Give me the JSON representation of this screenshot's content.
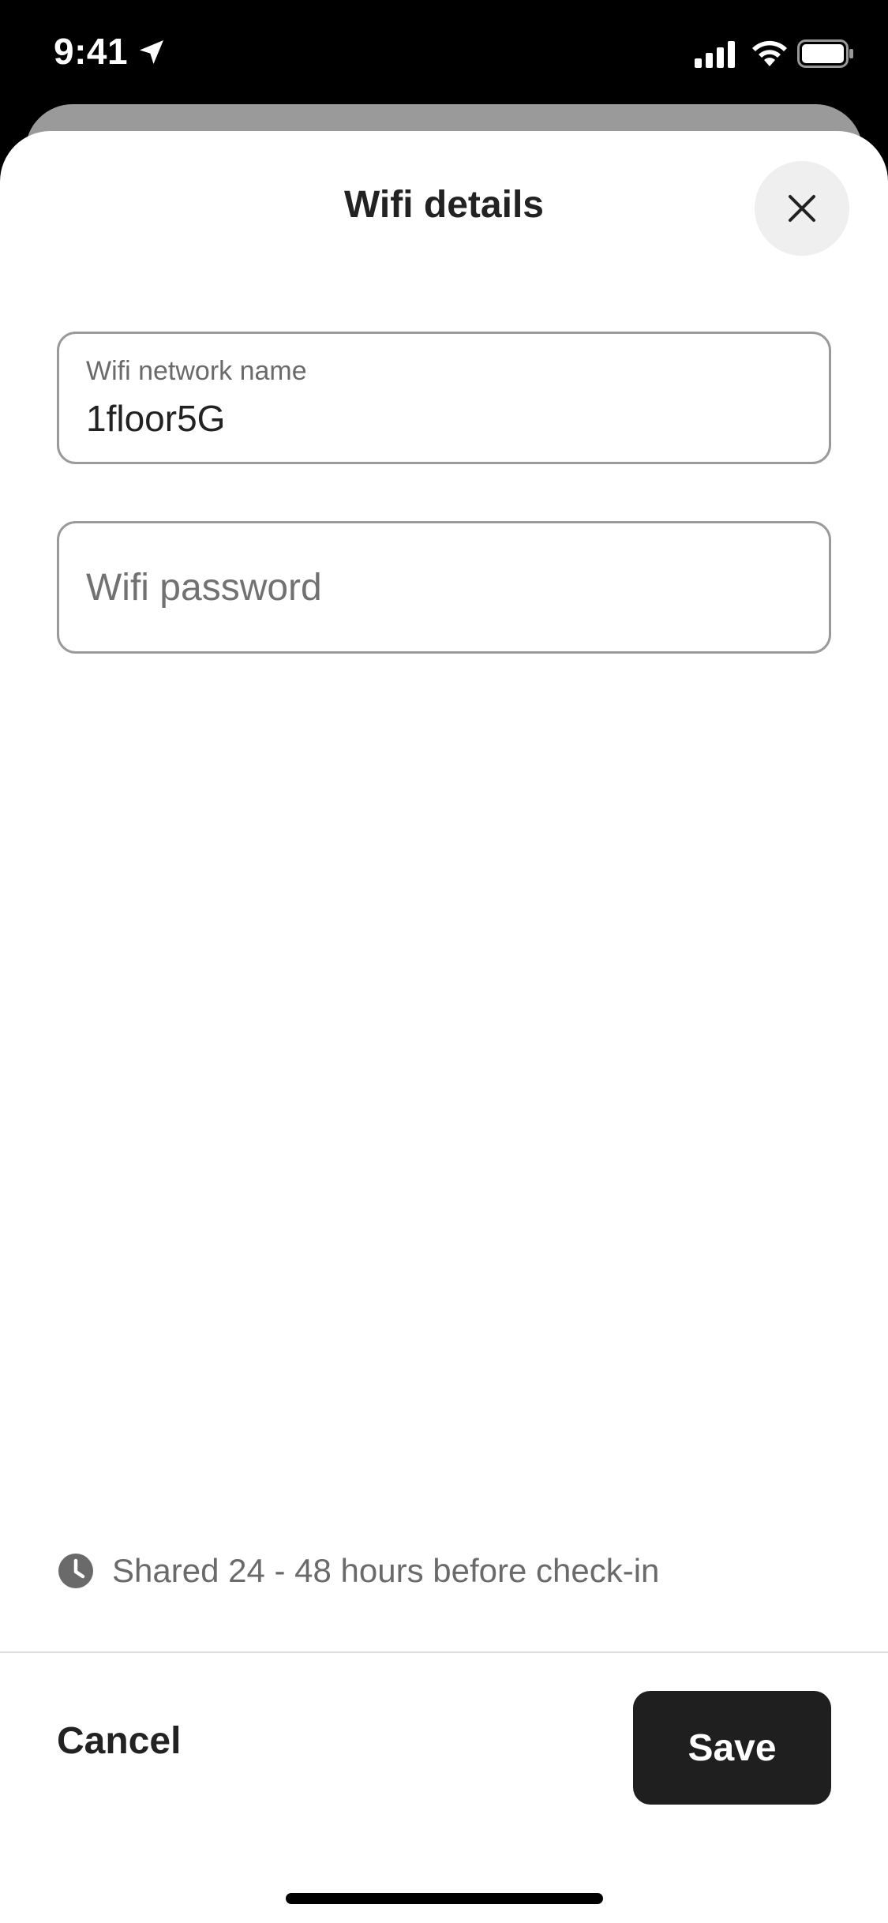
{
  "status_bar": {
    "time": "9:41"
  },
  "sheet": {
    "title": "Wifi details"
  },
  "network_field": {
    "label": "Wifi network name",
    "value": "1floor5G"
  },
  "password_field": {
    "placeholder": "Wifi password",
    "value": ""
  },
  "share_note": {
    "text": "Shared 24 - 48 hours before check-in"
  },
  "footer": {
    "cancel_label": "Cancel",
    "save_label": "Save"
  },
  "icons": {
    "close": "close-icon",
    "clock": "clock-icon",
    "location": "location-arrow-icon",
    "signal": "cellular-signal-icon",
    "wifi": "wifi-icon",
    "battery": "battery-icon"
  },
  "colors": {
    "primary_button": "#1f1f1f",
    "text": "#222222",
    "muted_text": "#6a6a6a",
    "field_border": "#9a9a9a"
  }
}
